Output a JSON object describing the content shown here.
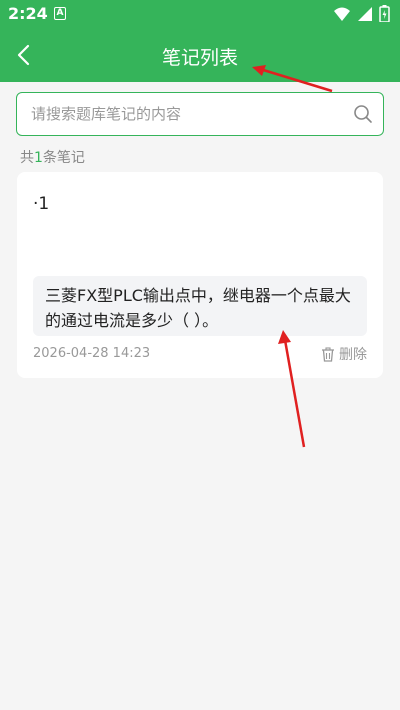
{
  "status_bar": {
    "time": "2:24",
    "notification_badge": "A"
  },
  "header": {
    "title": "笔记列表"
  },
  "search": {
    "placeholder": "请搜索题库笔记的内容"
  },
  "summary": {
    "prefix": "共",
    "count": "1",
    "suffix": "条笔记"
  },
  "notes": [
    {
      "text": "·1",
      "question": "三菱FX型PLC输出点中，继电器一个点最大的通过电流是多少（ ）。",
      "date": "2026-04-28 14:23",
      "delete_label": "删除"
    }
  ],
  "colors": {
    "brand": "#35b45a",
    "annotation_arrow": "#e02020"
  }
}
